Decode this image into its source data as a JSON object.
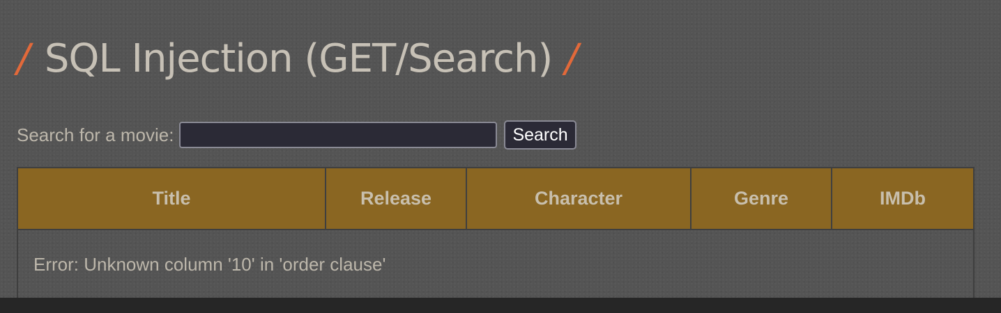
{
  "header": {
    "title": "SQL Injection (GET/Search)",
    "slash_left": "/",
    "slash_right": "/",
    "accent_color": "#e2693a"
  },
  "search": {
    "label": "Search for a movie:",
    "input_value": "",
    "button_label": "Search"
  },
  "table": {
    "header_color": "#8a6622",
    "columns": [
      "Title",
      "Release",
      "Character",
      "Genre",
      "IMDb"
    ],
    "message": "Error: Unknown column '10' in 'order clause'"
  }
}
